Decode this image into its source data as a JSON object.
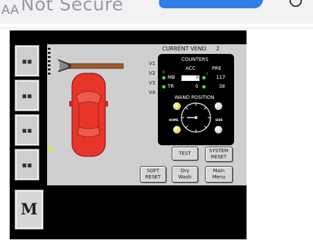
{
  "browser": {
    "url_status": "Not Secure",
    "menu_glyph": "AA"
  },
  "side_buttons": [
    {
      "label": "▪▪"
    },
    {
      "label": "▪▪"
    },
    {
      "label": "▪▪"
    },
    {
      "label": "▪▪"
    }
  ],
  "menu_button": {
    "label": "M"
  },
  "screen": {
    "current_vend_label": "CURRENT VEND",
    "current_vend_value": "2",
    "valves": [
      "V1",
      "V2",
      "V3",
      "V4"
    ]
  },
  "counters": {
    "title": "COUNTERS",
    "acc_label": "ACC",
    "pre_label": "PRE",
    "rows": [
      {
        "label": "MB",
        "acc": "0",
        "pre": "117"
      },
      {
        "label": "TR",
        "acc": "0",
        "pre": "38"
      }
    ],
    "small_marker_left": "R",
    "small_marker_right": "C",
    "wand_title": "WAND POSITION",
    "home_label": "HOME",
    "side_label": "SIDE"
  },
  "buttons": {
    "test": "TEST",
    "system_reset": [
      "SYSTEM",
      "RESET"
    ],
    "soft_reset": [
      "SOFT",
      "RESET"
    ],
    "dry_wash": [
      "Dry",
      "Wash"
    ],
    "main_menu": [
      "Main",
      "Menu"
    ]
  },
  "colors": {
    "car": "#e8352a",
    "panel": "#000000",
    "screen_bg": "#cfcfcf",
    "wand_bar": "#9b5a2c",
    "indicator_green": "#58d058",
    "url_blue": "#2f7fe8"
  }
}
